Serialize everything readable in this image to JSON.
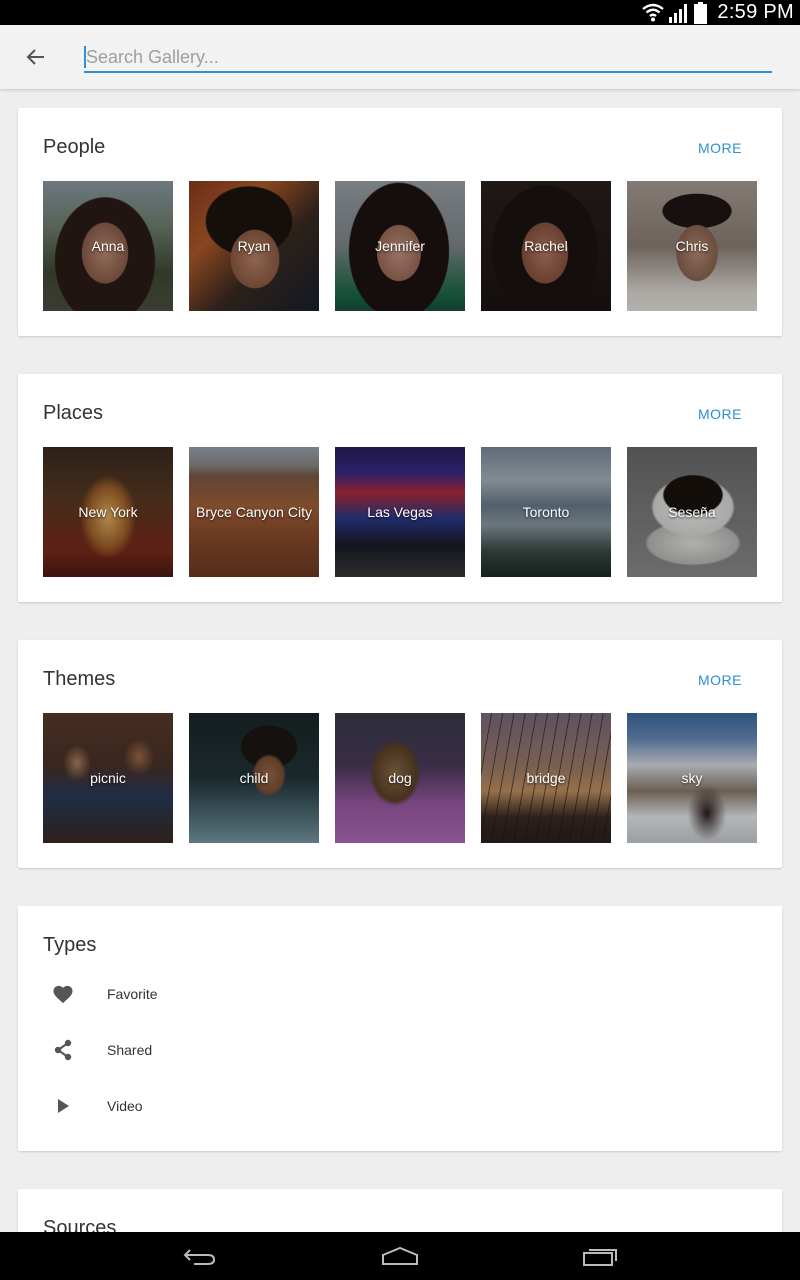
{
  "status_bar": {
    "time": "2:59 PM"
  },
  "search": {
    "placeholder": "Search Gallery..."
  },
  "sections": {
    "people": {
      "title": "People",
      "more": "MORE",
      "items": [
        "Anna",
        "Ryan",
        "Jennifer",
        "Rachel",
        "Chris"
      ]
    },
    "places": {
      "title": "Places",
      "more": "MORE",
      "items": [
        "New York",
        "Bryce Canyon City",
        "Las Vegas",
        "Toronto",
        "Seseña"
      ]
    },
    "themes": {
      "title": "Themes",
      "more": "MORE",
      "items": [
        "picnic",
        "child",
        "dog",
        "bridge",
        "sky"
      ]
    },
    "types": {
      "title": "Types",
      "items": [
        {
          "label": "Favorite",
          "icon": "heart-icon"
        },
        {
          "label": "Shared",
          "icon": "share-icon"
        },
        {
          "label": "Video",
          "icon": "play-icon"
        }
      ]
    },
    "sources": {
      "title": "Sources"
    }
  },
  "colors": {
    "accent": "#2c8ed6",
    "background": "#eeeeee"
  }
}
